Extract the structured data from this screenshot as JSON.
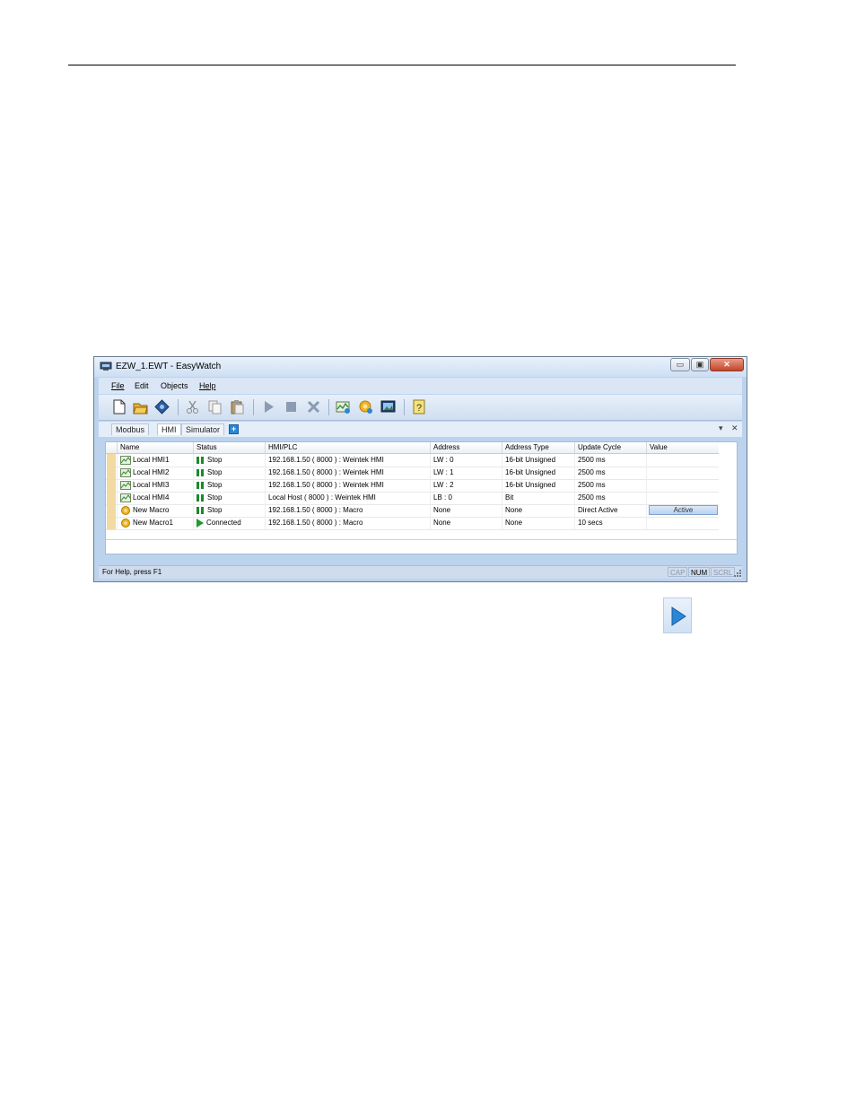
{
  "window": {
    "title": "EZW_1.EWT - EasyWatch",
    "minimize_label": "▭",
    "restore_label": "▣",
    "close_label": "✕"
  },
  "menu": [
    "File",
    "Edit",
    "Objects",
    "Help"
  ],
  "toolbar": {
    "icons": [
      "new-icon",
      "open-icon",
      "save-icon",
      "cut-icon",
      "copy-icon",
      "paste-icon",
      "run-icon",
      "stop-icon",
      "delete-icon",
      "add-hmi-icon",
      "add-macro-icon",
      "monitor-icon",
      "help-icon"
    ]
  },
  "tabs": {
    "items": [
      "Modbus",
      "HMI",
      "Simulator"
    ],
    "active": "HMI",
    "add_label": "+",
    "pin_label": "▾",
    "close_label": "✕"
  },
  "table": {
    "columns": [
      "Name",
      "Status",
      "HMI/PLC",
      "Address",
      "Address Type",
      "Update Cycle",
      "Value"
    ],
    "rows": [
      {
        "name": "Local HMI1",
        "type": "hmi",
        "status": "Stop",
        "state": "stop",
        "hmi_plc": "192.168.1.50 ( 8000 )  : Weintek HMI",
        "address": "LW : 0",
        "address_type": "16-bit Unsigned",
        "update_cycle": "2500 ms",
        "value": ""
      },
      {
        "name": "Local HMI2",
        "type": "hmi",
        "status": "Stop",
        "state": "stop",
        "hmi_plc": "192.168.1.50 ( 8000 )  : Weintek HMI",
        "address": "LW : 1",
        "address_type": "16-bit Unsigned",
        "update_cycle": "2500 ms",
        "value": ""
      },
      {
        "name": "Local HMI3",
        "type": "hmi",
        "status": "Stop",
        "state": "stop",
        "hmi_plc": "192.168.1.50 ( 8000 )  : Weintek HMI",
        "address": "LW : 2",
        "address_type": "16-bit Unsigned",
        "update_cycle": "2500 ms",
        "value": ""
      },
      {
        "name": "Local HMI4",
        "type": "hmi",
        "status": "Stop",
        "state": "stop",
        "hmi_plc": "Local Host ( 8000 )  : Weintek HMI",
        "address": "LB : 0",
        "address_type": "Bit",
        "update_cycle": "2500 ms",
        "value": ""
      },
      {
        "name": "New Macro",
        "type": "macro",
        "status": "Stop",
        "state": "stop",
        "hmi_plc": "192.168.1.50 ( 8000 )  : Macro",
        "address": "None",
        "address_type": "None",
        "update_cycle": "Direct Active",
        "value": "Active"
      },
      {
        "name": "New Macro1",
        "type": "macro",
        "status": "Connected",
        "state": "connected",
        "hmi_plc": "192.168.1.50 ( 8000 )  : Macro",
        "address": "None",
        "address_type": "None",
        "update_cycle": "10 secs",
        "value": ""
      }
    ]
  },
  "statusbar": {
    "help_text": "For Help, press F1",
    "indicators": [
      "CAP",
      "NUM",
      "SCRL"
    ]
  },
  "colors": {
    "accent": "#2a86d6",
    "status_green": "#1a8a2a",
    "window_frame": "#bcd3ee"
  }
}
